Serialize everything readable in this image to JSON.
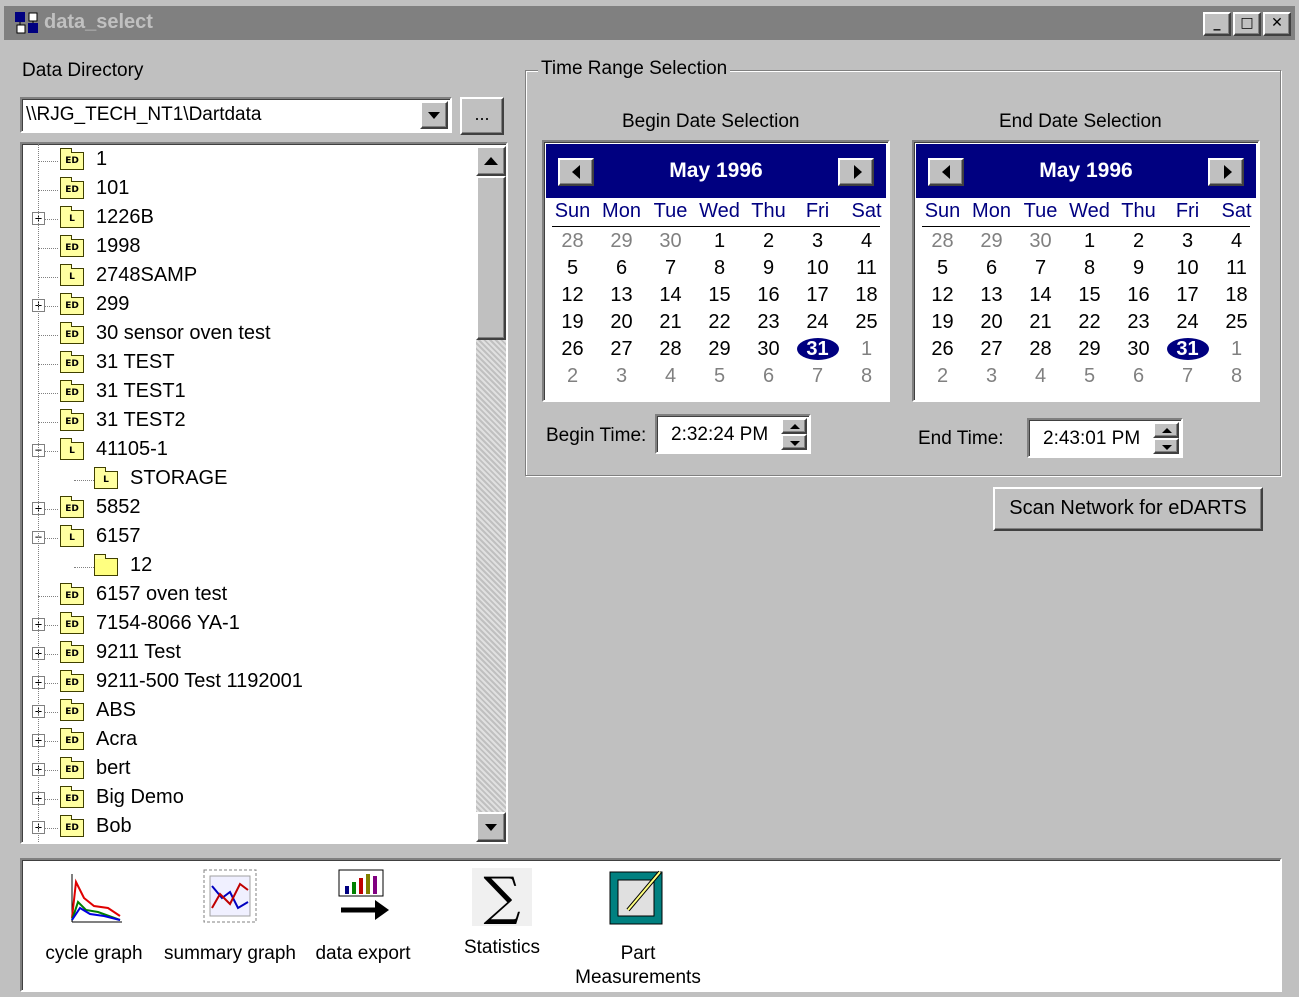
{
  "window": {
    "title": "data_select",
    "minimize": "_",
    "maximize": "□",
    "close": "✕"
  },
  "data_directory": {
    "label": "Data Directory",
    "path": "\\\\RJG_TECH_NT1\\Dartdata",
    "browse_label": "..."
  },
  "tree": {
    "items": [
      {
        "label": "1",
        "badge": "ED",
        "expander": ""
      },
      {
        "label": "101",
        "badge": "ED",
        "expander": ""
      },
      {
        "label": "1226B",
        "badge": "L",
        "expander": "+"
      },
      {
        "label": "1998",
        "badge": "ED",
        "expander": ""
      },
      {
        "label": "2748SAMP",
        "badge": "L",
        "expander": ""
      },
      {
        "label": "299",
        "badge": "ED",
        "expander": "+"
      },
      {
        "label": "30 sensor oven test",
        "badge": "ED",
        "expander": ""
      },
      {
        "label": "31 TEST",
        "badge": "ED",
        "expander": ""
      },
      {
        "label": "31 TEST1",
        "badge": "ED",
        "expander": ""
      },
      {
        "label": "31 TEST2",
        "badge": "ED",
        "expander": ""
      },
      {
        "label": "41105-1",
        "badge": "L",
        "expander": "−"
      },
      {
        "label": "STORAGE",
        "badge": "L",
        "expander": "",
        "child": true
      },
      {
        "label": "5852",
        "badge": "ED",
        "expander": "+"
      },
      {
        "label": "6157",
        "badge": "L",
        "expander": "−"
      },
      {
        "label": "12",
        "badge": "",
        "expander": "",
        "child": true,
        "open": true
      },
      {
        "label": "6157 oven test",
        "badge": "ED",
        "expander": ""
      },
      {
        "label": "7154-8066 YA-1",
        "badge": "ED",
        "expander": "+"
      },
      {
        "label": "9211 Test",
        "badge": "ED",
        "expander": "+"
      },
      {
        "label": "9211-500 Test 1192001",
        "badge": "ED",
        "expander": "+"
      },
      {
        "label": "ABS",
        "badge": "ED",
        "expander": "+"
      },
      {
        "label": "Acra",
        "badge": "ED",
        "expander": "+"
      },
      {
        "label": "bert",
        "badge": "ED",
        "expander": "+"
      },
      {
        "label": "Big Demo",
        "badge": "ED",
        "expander": "+"
      },
      {
        "label": "Bob",
        "badge": "ED",
        "expander": "+"
      }
    ]
  },
  "time_range": {
    "group_label": "Time Range Selection",
    "begin": {
      "heading": "Begin Date Selection",
      "month_label": "May 1996",
      "time_label": "Begin Time:",
      "time_value": "2:32:24 PM"
    },
    "end": {
      "heading": "End Date Selection",
      "month_label": "May 1996",
      "time_label": "End Time:",
      "time_value": "2:43:01 PM"
    },
    "weekdays": [
      "Sun",
      "Mon",
      "Tue",
      "Wed",
      "Thu",
      "Fri",
      "Sat"
    ],
    "days": [
      [
        "28",
        "29",
        "30",
        "1",
        "2",
        "3",
        "4"
      ],
      [
        "5",
        "6",
        "7",
        "8",
        "9",
        "10",
        "11"
      ],
      [
        "12",
        "13",
        "14",
        "15",
        "16",
        "17",
        "18"
      ],
      [
        "19",
        "20",
        "21",
        "22",
        "23",
        "24",
        "25"
      ],
      [
        "26",
        "27",
        "28",
        "29",
        "30",
        "31",
        "1"
      ],
      [
        "2",
        "3",
        "4",
        "5",
        "6",
        "7",
        "8"
      ]
    ],
    "selected_day": "31",
    "colors": {
      "header": "#000080",
      "muted": "#808080"
    }
  },
  "scan_button": "Scan Network for eDARTS",
  "tools": [
    {
      "label": "cycle graph",
      "icon": "cycle-graph-icon"
    },
    {
      "label": "summary graph",
      "icon": "summary-graph-icon"
    },
    {
      "label": "data export",
      "icon": "data-export-icon"
    },
    {
      "label": "Statistics",
      "icon": "sigma-icon",
      "glyph": "∑"
    },
    {
      "label": "Part Measurements",
      "icon": "part-measurements-icon"
    }
  ]
}
